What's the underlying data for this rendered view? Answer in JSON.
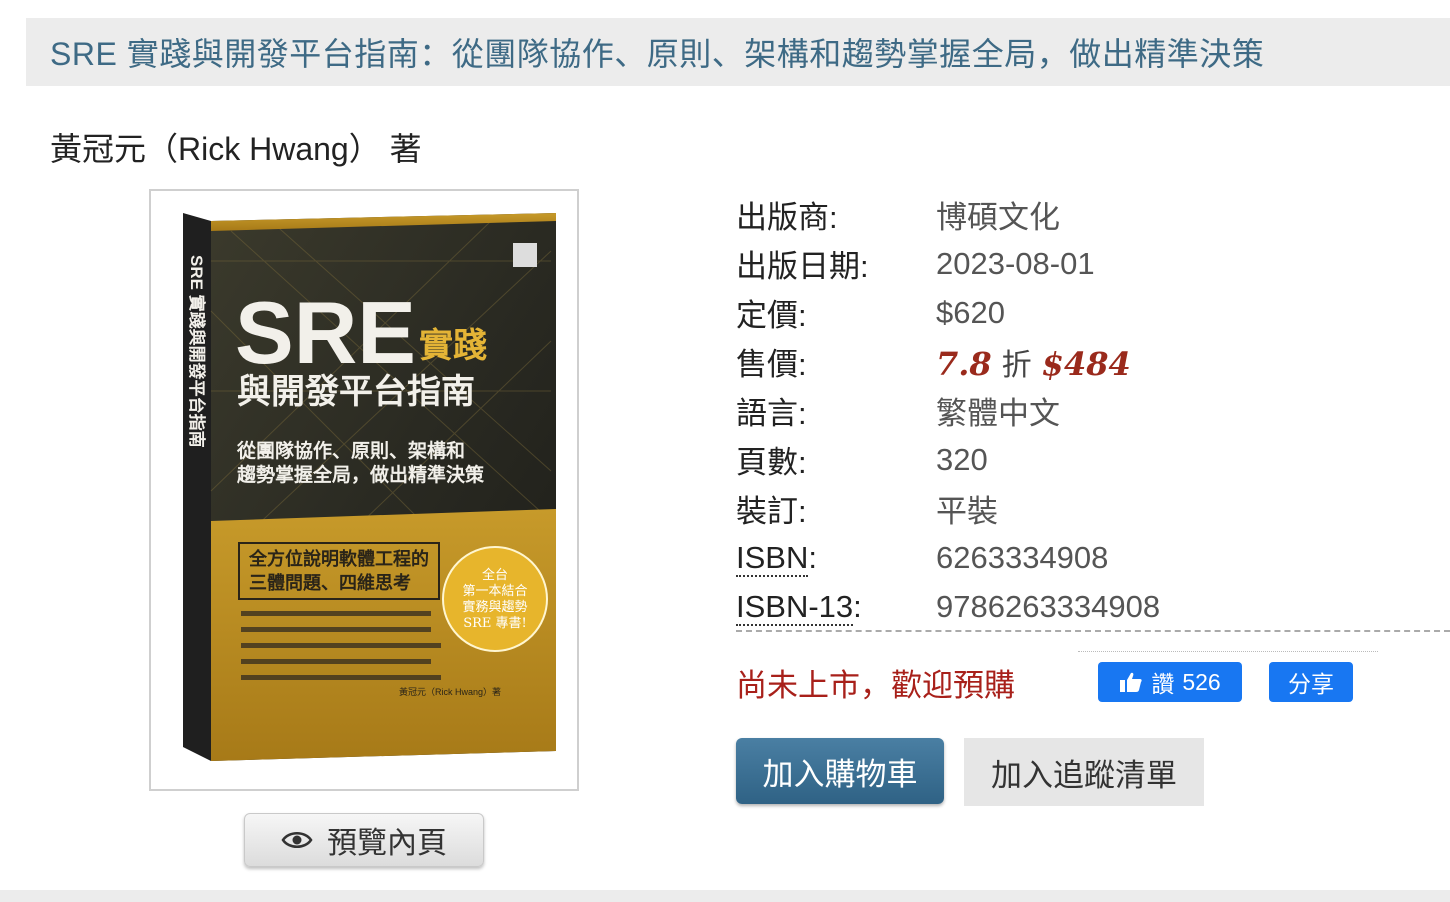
{
  "title": "SRE 實踐與開發平台指南：從團隊協作、原則、架構和趨勢掌握全局，做出精準決策",
  "author": "黃冠元（Rick Hwang） 著",
  "cover": {
    "big_title": "SRE",
    "title_rest_1": "實踐",
    "title_line_2": "與開發平台指南",
    "subtitle_1": "從團隊協作、原則、架構和",
    "subtitle_2": "趨勢掌握全局，做出精準決策",
    "spine_text": "SRE 實踐與開發平台指南",
    "highlight_1": "全方位說明軟體工程的",
    "highlight_2": "三體問題、四維思考",
    "badge_1": "全台",
    "badge_2": "第一本結合",
    "badge_3": "實務與趨勢",
    "badge_4": "SRE 專書!",
    "author_line": "黃冠元（Rick Hwang）著"
  },
  "preview_label": "預覽內頁",
  "info": {
    "publisher_label": "出版商:",
    "publisher": "博碩文化",
    "date_label": "出版日期:",
    "date": "2023-08-01",
    "list_price_label": "定價:",
    "list_price": "$620",
    "sale_label": "售價:",
    "discount": "7.8",
    "discount_unit": "折",
    "sale_price": "$484",
    "language_label": "語言:",
    "language": "繁體中文",
    "pages_label": "頁數:",
    "pages": "320",
    "binding_label": "裝訂:",
    "binding": "平裝",
    "isbn_label": "ISBN",
    "isbn_colon": ":",
    "isbn": "6263334908",
    "isbn13_label": "ISBN-13",
    "isbn13_colon": ":",
    "isbn13": "9786263334908"
  },
  "status": "尚未上市，歡迎預購",
  "social": {
    "like_label": "讚",
    "like_count": "526",
    "share_label": "分享"
  },
  "actions": {
    "cart": "加入購物車",
    "track": "加入追蹤清單"
  },
  "colors": {
    "title": "#3e6a85",
    "sale": "#9a2a1c",
    "status": "#a8201a",
    "facebook": "#1877f2",
    "cart": "#2f6285"
  },
  "icons": [
    "eye-icon",
    "thumbs-up-icon"
  ]
}
